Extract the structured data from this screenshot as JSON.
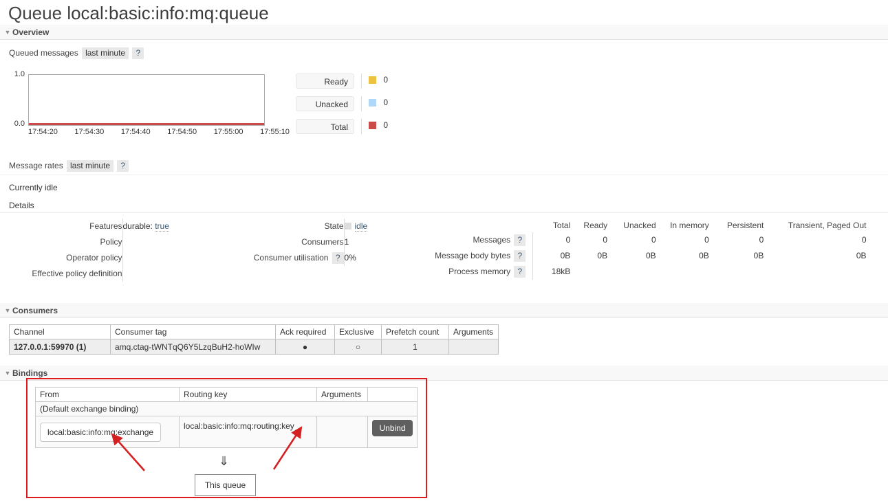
{
  "page": {
    "title_prefix": "Queue",
    "queue_name": "local:basic:info:mq:queue"
  },
  "sections": {
    "overview": "Overview",
    "consumers": "Consumers",
    "bindings": "Bindings"
  },
  "queued_messages": {
    "label": "Queued messages",
    "period": "last minute",
    "help": "?"
  },
  "chart_data": {
    "type": "line",
    "title": "Queued messages",
    "xlabel": "",
    "ylabel": "",
    "ylim": [
      0.0,
      1.0
    ],
    "ytick_labels": [
      "1.0",
      "0.0"
    ],
    "x": [
      "17:54:20",
      "17:54:30",
      "17:54:40",
      "17:54:50",
      "17:55:00",
      "17:55:10"
    ],
    "grid": false,
    "legend_position": "right",
    "series": [
      {
        "name": "Ready",
        "value": "0",
        "color": "#edc240",
        "values": [
          0,
          0,
          0,
          0,
          0,
          0
        ]
      },
      {
        "name": "Unacked",
        "value": "0",
        "color": "#afd8f8",
        "values": [
          0,
          0,
          0,
          0,
          0,
          0
        ]
      },
      {
        "name": "Total",
        "value": "0",
        "color": "#cb4b4b",
        "values": [
          0,
          0,
          0,
          0,
          0,
          0
        ]
      }
    ]
  },
  "message_rates": {
    "label": "Message rates",
    "period": "last minute",
    "help": "?",
    "status": "Currently idle",
    "details_label": "Details"
  },
  "details": {
    "left": [
      {
        "key": "Features",
        "value": "durable: true",
        "value_plain": "durable: ",
        "value_dotted": "true"
      },
      {
        "key": "Policy",
        "value": ""
      },
      {
        "key": "Operator policy",
        "value": ""
      },
      {
        "key": "Effective policy definition",
        "value": ""
      }
    ],
    "middle": [
      {
        "key": "State",
        "value": "idle",
        "icon": "state-square-icon"
      },
      {
        "key": "Consumers",
        "value": "1"
      },
      {
        "key": "Consumer utilisation",
        "help": "?",
        "value": "0%"
      }
    ],
    "stats": {
      "columns": [
        "Total",
        "Ready",
        "Unacked",
        "In memory",
        "Persistent",
        "Transient, Paged Out"
      ],
      "rows": [
        {
          "label": "Messages",
          "help": "?",
          "values": [
            "0",
            "0",
            "0",
            "0",
            "0",
            "0"
          ]
        },
        {
          "label": "Message body bytes",
          "help": "?",
          "values": [
            "0B",
            "0B",
            "0B",
            "0B",
            "0B",
            "0B"
          ]
        },
        {
          "label": "Process memory",
          "help": "?",
          "values": [
            "18kB",
            "",
            "",
            "",
            "",
            ""
          ]
        }
      ]
    }
  },
  "consumers_table": {
    "columns": [
      "Channel",
      "Consumer tag",
      "Ack required",
      "Exclusive",
      "Prefetch count",
      "Arguments"
    ],
    "rows": [
      {
        "channel": "127.0.0.1:59970 (1)",
        "consumer_tag": "amq.ctag-tWNTqQ6Y5LzqBuH2-hoWIw",
        "ack_required": "●",
        "exclusive": "○",
        "prefetch_count": "1",
        "arguments": ""
      }
    ]
  },
  "bindings_table": {
    "columns": [
      "From",
      "Routing key",
      "Arguments",
      ""
    ],
    "default_row": "(Default exchange binding)",
    "rows": [
      {
        "from": "local:basic:info:mq:exchange",
        "routing_key": "local:basic:info:mq:routing:key",
        "arguments": "",
        "action": "Unbind"
      }
    ],
    "arrow_glyph": "⇓",
    "this_queue": "This queue"
  },
  "annotations": {
    "highlight_color": "#e01b1b",
    "arrow_color": "#d42020"
  }
}
